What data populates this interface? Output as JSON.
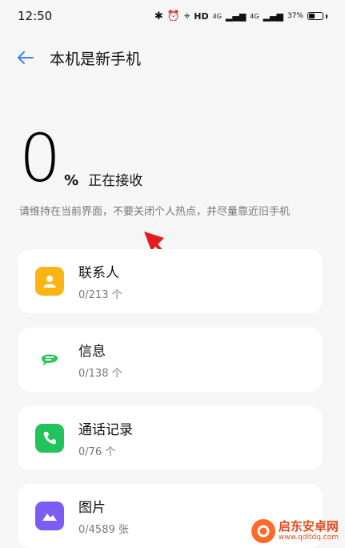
{
  "status_bar": {
    "time": "12:50",
    "hd_label": "HD",
    "signal_1": "4G",
    "signal_2": "4G",
    "battery_text": "37%",
    "battery_level": 0.37
  },
  "header": {
    "title": "本机是新手机"
  },
  "progress": {
    "value": "0",
    "unit": "%",
    "status": "正在接收",
    "hint": "请维持在当前界面，不要关闭个人热点，并尽量靠近旧手机"
  },
  "items": [
    {
      "label": "联系人",
      "count": "0/213 个",
      "icon": "contacts-icon",
      "color": "#fbb414"
    },
    {
      "label": "信息",
      "count": "0/138 个",
      "icon": "message-icon",
      "color": "#2fc45d"
    },
    {
      "label": "通话记录",
      "count": "0/76 个",
      "icon": "phone-icon",
      "color": "#23c35b"
    },
    {
      "label": "图片",
      "count": "0/4589 张",
      "icon": "photo-icon",
      "color": "#7b5cf5"
    }
  ],
  "colors": {
    "accent": "#3b82f6",
    "arrow": "#e31c1c"
  },
  "watermark": {
    "name": "启东安卓网",
    "url": "www.qdltdq.com"
  }
}
